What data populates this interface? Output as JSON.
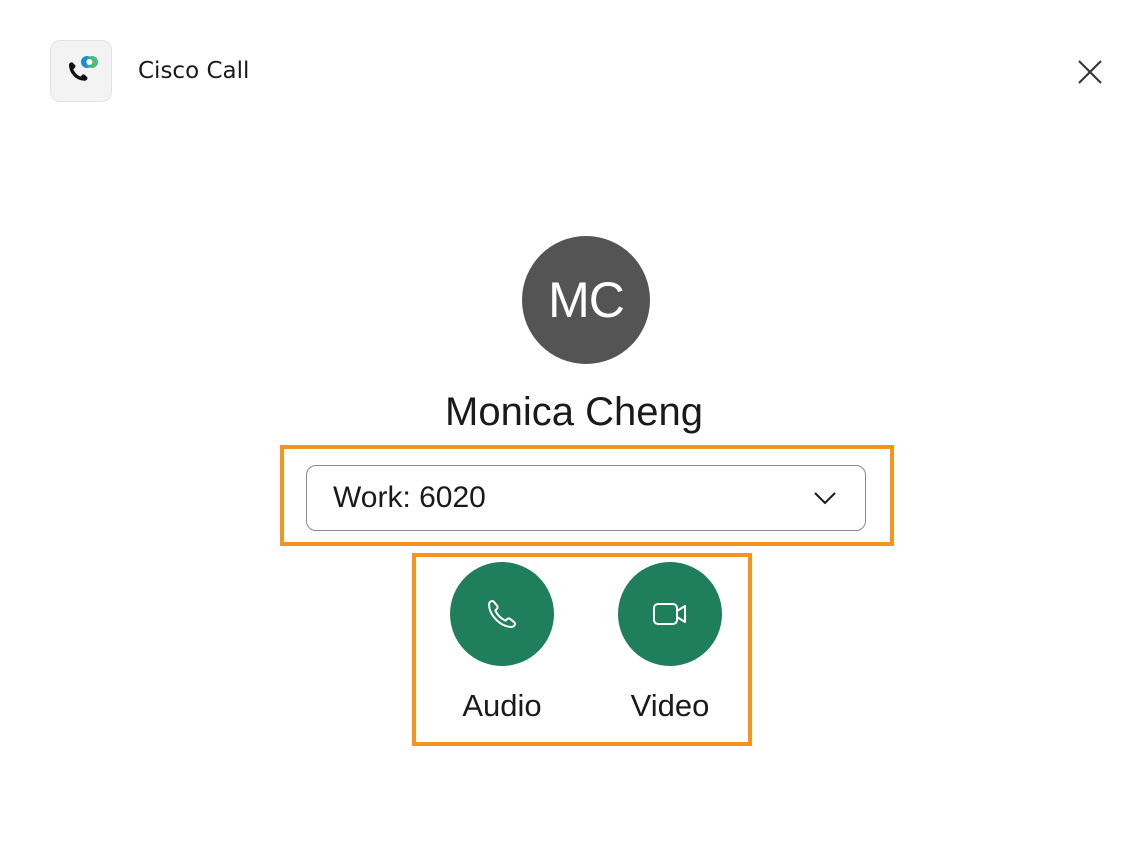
{
  "window": {
    "title": "Cisco Call",
    "app_icon": "cisco-call-app-icon",
    "close_icon": "close-icon"
  },
  "contact": {
    "initials": "MC",
    "name": "Monica Cheng",
    "avatar_color": "#545454"
  },
  "number_select": {
    "selected": "Work: 6020",
    "icon": "chevron-down-icon"
  },
  "actions": {
    "audio": {
      "label": "Audio",
      "icon": "phone-icon"
    },
    "video": {
      "label": "Video",
      "icon": "video-camera-icon"
    },
    "button_color": "#1f7f5c"
  },
  "highlight_color": "#f7941d"
}
